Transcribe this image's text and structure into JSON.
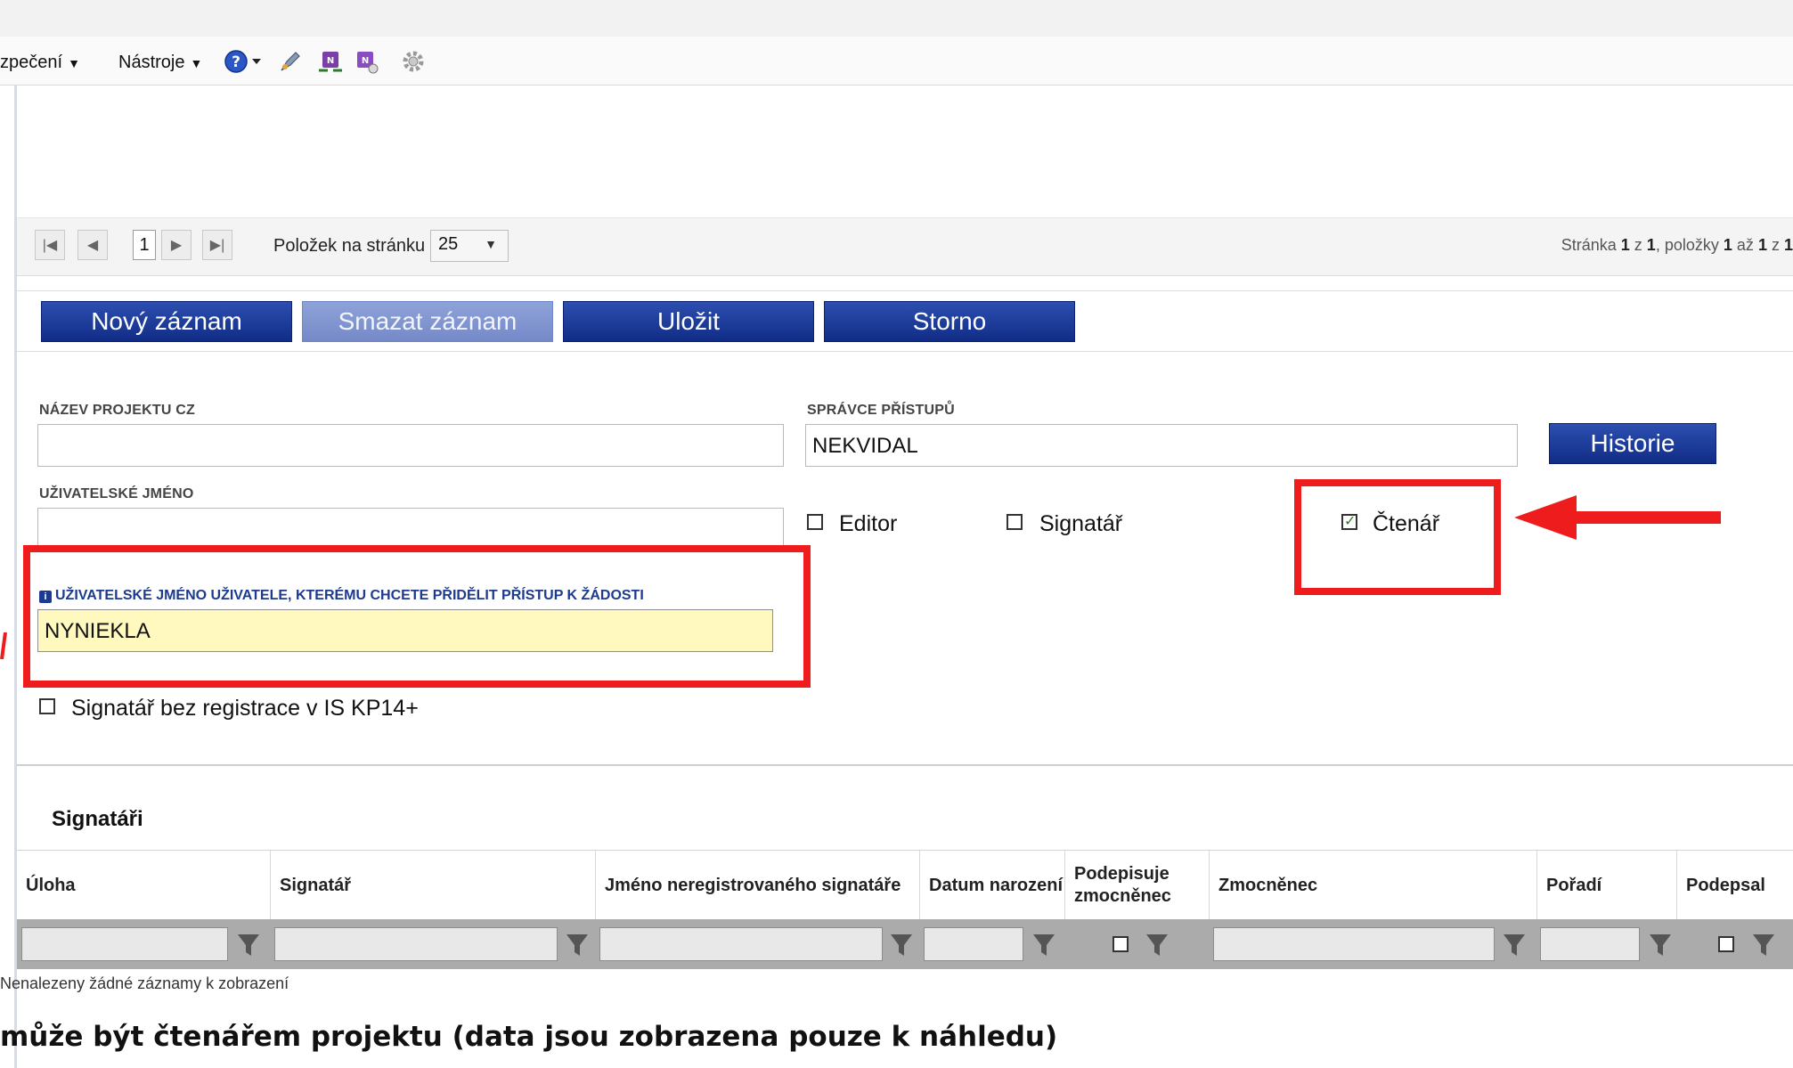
{
  "toolbar": {
    "menus": [
      {
        "label": "zpečení"
      },
      {
        "label": "Nástroje"
      }
    ],
    "icons": [
      "help-icon",
      "pen-icon",
      "note-link-icon",
      "note-app-icon",
      "gear-icon"
    ]
  },
  "pager": {
    "current_page": "1",
    "per_page_label": "Položek na stránku",
    "per_page_value": "25",
    "info_prefix": "Stránka",
    "info_page": "1",
    "info_of": "z",
    "info_total_pages": "1",
    "info_items_label": ", položky",
    "info_from": "1",
    "info_to_label": "až",
    "info_to": "1",
    "info_of2": "z",
    "info_total": "1"
  },
  "actions": {
    "new": "Nový záznam",
    "delete": "Smazat záznam",
    "save": "Uložit",
    "cancel": "Storno"
  },
  "form": {
    "project_name_label": "NÁZEV PROJEKTU CZ",
    "project_name_value": "",
    "access_admin_label": "SPRÁVCE PŘÍSTUPŮ",
    "access_admin_value": "NEKVIDAL",
    "history_button": "Historie",
    "username_label": "UŽIVATELSKÉ JMÉNO",
    "username_value": "",
    "editor_label": "Editor",
    "signatory_label": "Signatář",
    "reader_label": "Čtenář",
    "reader_checked": true,
    "target_user_label": "UŽIVATELSKÉ JMÉNO UŽIVATELE, KTERÉMU CHCETE PŘIDĚLIT PŘÍSTUP K ŽÁDOSTI",
    "target_user_value": "NYNIEKLA",
    "unregistered_signatory_label": "Signatář bez registrace v IS KP14+"
  },
  "signatories": {
    "title": "Signatáři",
    "columns": [
      "Úloha",
      "Signatář",
      "Jméno neregistrovaného signatáře",
      "Datum narození",
      "Podepisuje zmocněnec",
      "Zmocněnec",
      "Pořadí",
      "Podepsal"
    ],
    "empty_text": "Nenalezeny žádné záznamy k zobrazení"
  },
  "caption": "může být čtenářem projektu (data jsou zobrazena pouze k náhledu)",
  "colors": {
    "button_primary": "#1a3a9a",
    "button_disabled": "#8298d4",
    "highlight_red": "#ee1c1c",
    "input_highlight": "#fff9c0"
  }
}
